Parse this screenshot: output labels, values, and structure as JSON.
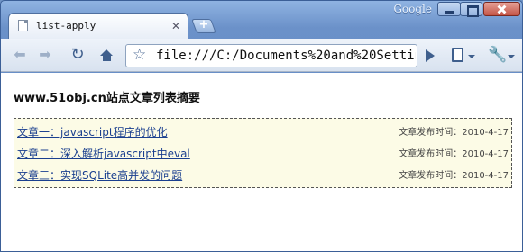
{
  "browser": {
    "brand_label": "Google",
    "tab_title": "list-apply",
    "url": "file:///C:/Documents%20and%20Setting"
  },
  "page": {
    "heading": "www.51obj.cn站点文章列表摘要",
    "articles": [
      {
        "title": "文章一：javascript程序的优化",
        "time_label": "文章发布时间：2010-4-17"
      },
      {
        "title": "文章二：深入解析javascript中eval",
        "time_label": "文章发布时间：2010-4-17"
      },
      {
        "title": "文章三：实现SQLite高并发的问题",
        "time_label": "文章发布时间：2010-4-17"
      }
    ]
  },
  "icons": [
    "page-icon",
    "close-icon",
    "new-tab-icon",
    "back-icon",
    "forward-icon",
    "reload-icon",
    "home-icon",
    "star-icon",
    "go-icon",
    "page-menu-icon",
    "wrench-icon"
  ]
}
